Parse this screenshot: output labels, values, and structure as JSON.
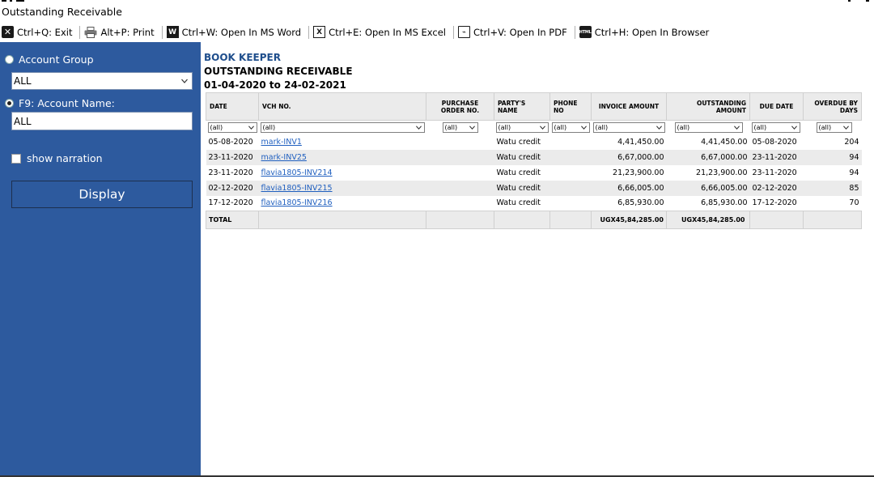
{
  "window": {
    "title": "Outstanding Receivable"
  },
  "toolbar": [
    {
      "key": "exit",
      "icon": "exit-icon",
      "glyph": "✕",
      "label": "Ctrl+Q: Exit"
    },
    {
      "key": "print",
      "icon": "printer-icon",
      "glyph": "",
      "label": "Alt+P: Print"
    },
    {
      "key": "word",
      "icon": "word-icon",
      "glyph": "W",
      "label": "Ctrl+W: Open In MS Word"
    },
    {
      "key": "excel",
      "icon": "excel-icon",
      "glyph": "X",
      "label": "Ctrl+E: Open In MS Excel"
    },
    {
      "key": "pdf",
      "icon": "pdf-icon",
      "glyph": "⌁",
      "label": "Ctrl+V: Open In PDF"
    },
    {
      "key": "browser",
      "icon": "html-icon",
      "glyph": "HTML",
      "label": "Ctrl+H: Open In Browser"
    }
  ],
  "sidebar": {
    "account_group_label": "Account Group",
    "account_group_value": "ALL",
    "account_name_label": "F9: Account Name:",
    "account_name_value": "ALL",
    "show_narration_label": "show narration",
    "display_label": "Display"
  },
  "report": {
    "company": "BOOK KEEPER",
    "title": "OUTSTANDING RECEIVABLE",
    "range": "01-04-2020 to 24-02-2021"
  },
  "table": {
    "columns": [
      {
        "key": "date",
        "label": "DATE",
        "align": "left",
        "filter": "(all)"
      },
      {
        "key": "vch",
        "label": "VCH NO.",
        "align": "left",
        "filter": "(all)"
      },
      {
        "key": "po",
        "label": "PURCHASE ORDER NO.",
        "align": "center",
        "filter": "(all)"
      },
      {
        "key": "party",
        "label": "PARTY'S NAME",
        "align": "left",
        "filter": "(all)"
      },
      {
        "key": "phone",
        "label": "PHONE NO",
        "align": "left",
        "filter": "(all)"
      },
      {
        "key": "invoice",
        "label": "INVOICE AMOUNT",
        "align": "center",
        "filter": "(all)"
      },
      {
        "key": "outstanding",
        "label": "OUTSTANDING AMOUNT",
        "align": "right",
        "filter": "(all)"
      },
      {
        "key": "due",
        "label": "DUE DATE",
        "align": "center",
        "filter": "(all)"
      },
      {
        "key": "overdue",
        "label": "OVERDUE BY DAYS",
        "align": "right",
        "filter": "(all)"
      }
    ],
    "rows": [
      {
        "date": "05-08-2020",
        "vch": "mark-INV1",
        "po": "",
        "party": "Watu credit",
        "phone": "",
        "invoice": "4,41,450.00",
        "outstanding": "4,41,450.00",
        "due": "05-08-2020",
        "overdue": "204"
      },
      {
        "date": "23-11-2020",
        "vch": "mark-INV25",
        "po": "",
        "party": "Watu credit",
        "phone": "",
        "invoice": "6,67,000.00",
        "outstanding": "6,67,000.00",
        "due": "23-11-2020",
        "overdue": "94"
      },
      {
        "date": "23-11-2020",
        "vch": "flavia1805-INV214",
        "po": "",
        "party": "Watu credit",
        "phone": "",
        "invoice": "21,23,900.00",
        "outstanding": "21,23,900.00",
        "due": "23-11-2020",
        "overdue": "94"
      },
      {
        "date": "02-12-2020",
        "vch": "flavia1805-INV215",
        "po": "",
        "party": "Watu credit",
        "phone": "",
        "invoice": "6,66,005.00",
        "outstanding": "6,66,005.00",
        "due": "02-12-2020",
        "overdue": "85"
      },
      {
        "date": "17-12-2020",
        "vch": "flavia1805-INV216",
        "po": "",
        "party": "Watu credit",
        "phone": "",
        "invoice": "6,85,930.00",
        "outstanding": "6,85,930.00",
        "due": "17-12-2020",
        "overdue": "70"
      }
    ],
    "total": {
      "label": "TOTAL",
      "invoice": "UGX45,84,285.00",
      "outstanding": "UGX45,84,285.00"
    }
  }
}
